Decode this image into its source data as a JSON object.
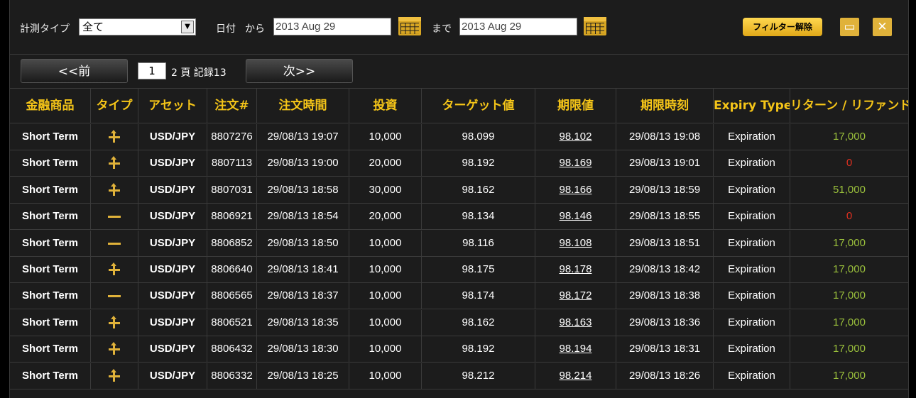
{
  "filter": {
    "type_label": "計測タイプ",
    "type_value": "全て",
    "date_label": "日付",
    "from_label": "から",
    "from_date": "2013 Aug 29",
    "to_label": "まで",
    "to_date": "2013 Aug 29",
    "clear_label": "フィルター解除"
  },
  "pager": {
    "prev_label": "<<前",
    "next_label": "次>>",
    "current_page": "1",
    "info": "2 頁 記録13"
  },
  "columns": [
    "金融商品",
    "タイプ",
    "アセット",
    "注文#",
    "注文時間",
    "投資",
    "ターゲット値",
    "期限値",
    "期限時刻",
    "Expiry Type",
    "リターン / リファンド"
  ],
  "rows": [
    {
      "product": "Short Term",
      "type": "up",
      "asset": "USD/JPY",
      "order": "8807276",
      "time": "29/08/13 19:07",
      "invest": "10,000",
      "target": "98.099",
      "expiry_value": "98.102",
      "expiry_time": "29/08/13 19:08",
      "expiry_type": "Expiration",
      "ret": "17,000"
    },
    {
      "product": "Short Term",
      "type": "up",
      "asset": "USD/JPY",
      "order": "8807113",
      "time": "29/08/13 19:00",
      "invest": "20,000",
      "target": "98.192",
      "expiry_value": "98.169",
      "expiry_time": "29/08/13 19:01",
      "expiry_type": "Expiration",
      "ret": "0"
    },
    {
      "product": "Short Term",
      "type": "up",
      "asset": "USD/JPY",
      "order": "8807031",
      "time": "29/08/13 18:58",
      "invest": "30,000",
      "target": "98.162",
      "expiry_value": "98.166",
      "expiry_time": "29/08/13 18:59",
      "expiry_type": "Expiration",
      "ret": "51,000"
    },
    {
      "product": "Short Term",
      "type": "flat",
      "asset": "USD/JPY",
      "order": "8806921",
      "time": "29/08/13 18:54",
      "invest": "20,000",
      "target": "98.134",
      "expiry_value": "98.146",
      "expiry_time": "29/08/13 18:55",
      "expiry_type": "Expiration",
      "ret": "0"
    },
    {
      "product": "Short Term",
      "type": "flat",
      "asset": "USD/JPY",
      "order": "8806852",
      "time": "29/08/13 18:50",
      "invest": "10,000",
      "target": "98.116",
      "expiry_value": "98.108",
      "expiry_time": "29/08/13 18:51",
      "expiry_type": "Expiration",
      "ret": "17,000"
    },
    {
      "product": "Short Term",
      "type": "up",
      "asset": "USD/JPY",
      "order": "8806640",
      "time": "29/08/13 18:41",
      "invest": "10,000",
      "target": "98.175",
      "expiry_value": "98.178",
      "expiry_time": "29/08/13 18:42",
      "expiry_type": "Expiration",
      "ret": "17,000"
    },
    {
      "product": "Short Term",
      "type": "flat",
      "asset": "USD/JPY",
      "order": "8806565",
      "time": "29/08/13 18:37",
      "invest": "10,000",
      "target": "98.174",
      "expiry_value": "98.172",
      "expiry_time": "29/08/13 18:38",
      "expiry_type": "Expiration",
      "ret": "17,000"
    },
    {
      "product": "Short Term",
      "type": "up",
      "asset": "USD/JPY",
      "order": "8806521",
      "time": "29/08/13 18:35",
      "invest": "10,000",
      "target": "98.162",
      "expiry_value": "98.163",
      "expiry_time": "29/08/13 18:36",
      "expiry_type": "Expiration",
      "ret": "17,000"
    },
    {
      "product": "Short Term",
      "type": "up",
      "asset": "USD/JPY",
      "order": "8806432",
      "time": "29/08/13 18:30",
      "invest": "10,000",
      "target": "98.192",
      "expiry_value": "98.194",
      "expiry_time": "29/08/13 18:31",
      "expiry_type": "Expiration",
      "ret": "17,000"
    },
    {
      "product": "Short Term",
      "type": "up",
      "asset": "USD/JPY",
      "order": "8806332",
      "time": "29/08/13 18:25",
      "invest": "10,000",
      "target": "98.212",
      "expiry_value": "98.214",
      "expiry_time": "29/08/13 18:26",
      "expiry_type": "Expiration",
      "ret": "17,000"
    }
  ],
  "colors": {
    "accent": "#f5c518",
    "positive": "#9bc13c",
    "zero": "#e03020",
    "icon": "#e0b23a"
  },
  "icons": {
    "calendar": "calendar-icon",
    "print": "print-icon",
    "export": "excel-export-icon"
  }
}
